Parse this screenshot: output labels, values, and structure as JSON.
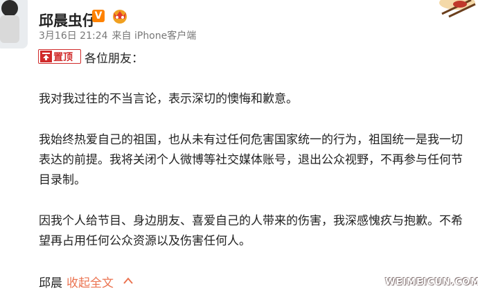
{
  "user": {
    "name": "邱晨虫仔",
    "verified_badge": "V",
    "time": "3月16日 21:24",
    "source": "来自 iPhone客户端"
  },
  "post": {
    "pin_label": "置顶",
    "greeting": "各位朋友：",
    "paragraphs": [
      "我对我过往的不当言论，表示深切的懊悔和歉意。",
      "我始终热爱自己的祖国，也从未有过任何危害国家统一的行为，祖国统一是我一切表达的前提。我将关闭个人微博等社交媒体账号，退出公众视野，不再参与任何节目录制。",
      "因我个人给节目、身边朋友、喜爱自己的人带来的伤害，我深感愧疚与抱歉。不希望再占用任何公众资源以及伤害任何人。"
    ],
    "signature": "邱晨",
    "collapse_label": "收起全文"
  },
  "watermark": "WEIMEICUN.COM",
  "colors": {
    "pin": "#d02a2a",
    "link": "#eb7350",
    "verified": "#ff8200"
  }
}
